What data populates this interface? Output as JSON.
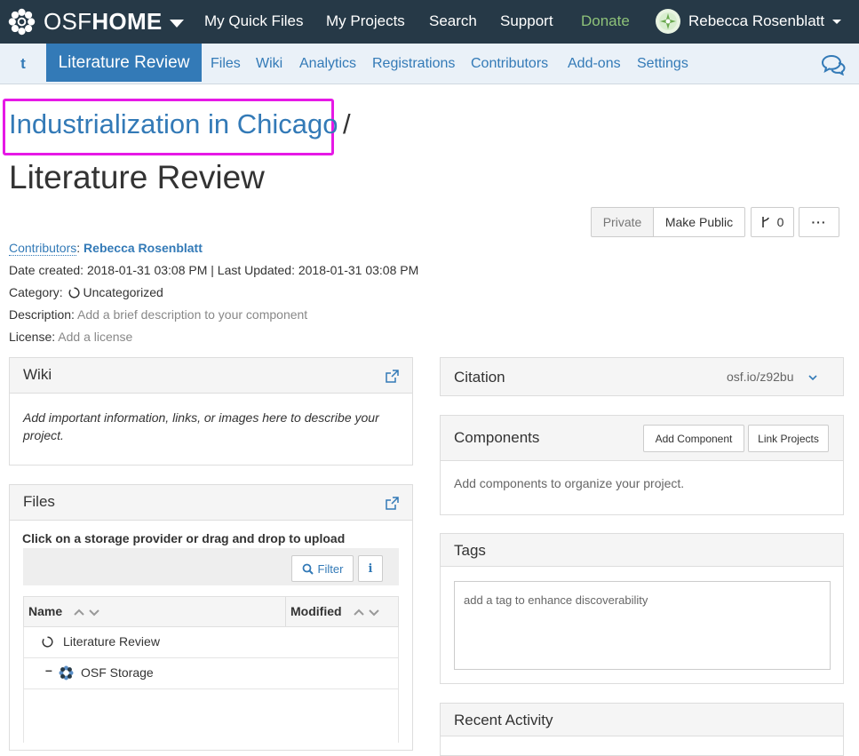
{
  "topnav": {
    "brand_prefix": "OSF",
    "brand_bold": "HOME",
    "items": [
      "My Quick Files",
      "My Projects",
      "Search",
      "Support",
      "Donate"
    ],
    "user_name": "Rebecca Rosenblatt"
  },
  "subnav": {
    "back_label": "t",
    "active": "Literature Review",
    "items": [
      "Files",
      "Wiki",
      "Analytics",
      "Registrations",
      "Contributors",
      "Add-ons",
      "Settings"
    ]
  },
  "title": {
    "parent": "Industrialization in Chicago",
    "separator": "/",
    "current": "Literature Review"
  },
  "actions": {
    "private": "Private",
    "make_public": "Make Public",
    "fork_count": "0",
    "more": "···"
  },
  "meta": {
    "contributors_label": "Contributors",
    "contributors_colon": ":",
    "contributor": "Rebecca Rosenblatt",
    "dates": "Date created: 2018-01-31 03:08 PM | Last Updated: 2018-01-31 03:08 PM",
    "category_label": "Category:",
    "category": "Uncategorized",
    "description_label": "Description:",
    "description": "Add a brief description to your component",
    "license_label": "License:",
    "license": "Add a license"
  },
  "wiki": {
    "title": "Wiki",
    "body": "Add important information, links, or images here to describe your project."
  },
  "files": {
    "title": "Files",
    "instruction": "Click on a storage provider or drag and drop to upload",
    "filter": "Filter",
    "col_name": "Name",
    "col_modified": "Modified",
    "rows": [
      "Literature Review",
      "OSF Storage"
    ]
  },
  "citation": {
    "title": "Citation",
    "link": "osf.io/z92bu"
  },
  "components": {
    "title": "Components",
    "add": "Add Component",
    "link": "Link Projects",
    "body": "Add components to organize your project."
  },
  "tags": {
    "title": "Tags",
    "placeholder": "add a tag to enhance discoverability"
  },
  "recent": {
    "title": "Recent Activity"
  },
  "colors": {
    "navbar": "#263947",
    "link": "#337ab7",
    "donate": "#8ec279",
    "highlight": "#e619e6"
  }
}
